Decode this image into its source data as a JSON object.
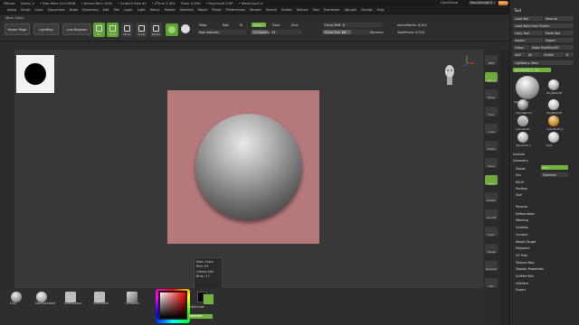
{
  "titlebar": {
    "items": [
      "ZBrush",
      "Demo_3",
      "• Free Mem 21.026GB",
      "• Active Mem 1004",
      "• Scratch Disk 49",
      "• ZTime 3.354",
      "Timer 0.009",
      "• PolyCount 0 KP",
      "• MeshCount 0"
    ],
    "quicksave": "QuickSave",
    "seethrough": "See-through 0",
    "menus": "Menus",
    "defaultscript": "DefaultZScript"
  },
  "menubar": [
    "Alpha",
    "Brush",
    "Color",
    "Document",
    "Draw",
    "Dynamics",
    "Edit",
    "File",
    "Layer",
    "Light",
    "Macro",
    "Marker",
    "Material",
    "Movie",
    "Picker",
    "Preferences",
    "Render",
    "Stencil",
    "Stroke",
    "Texture",
    "Tool",
    "Transform",
    "Zplugin",
    "Zscript",
    "Help"
  ],
  "header": {
    "main_color_label": "Main Color"
  },
  "shelf": {
    "home_page": "Home Page",
    "lightbox": "LightBox",
    "live_boolean": "Live Boolean",
    "tools": [
      {
        "label": "Edit",
        "active": true
      },
      {
        "label": "Draw",
        "active": true
      },
      {
        "label": "Move",
        "active": false
      },
      {
        "label": "Scale",
        "active": false
      },
      {
        "label": "Rotate",
        "active": false
      }
    ],
    "mrgb": "Mrgb",
    "rgb": "Rgb",
    "m": "M",
    "zadd": "Zadd",
    "zsub": "Zsub",
    "zcut": "Zcut",
    "rgb_intensity": "Rgb Intensity",
    "z_intensity_label": "Z Intensity",
    "z_intensity_value": "25",
    "focal_shift_label": "Focal Shift",
    "focal_shift_value": "0",
    "draw_size_label": "Draw Size",
    "draw_size_value": "64",
    "dynamic": "Dynamic",
    "active_points": "ActivePoints: 8,320",
    "total_points": "TotalPoints: 8,320"
  },
  "tooltip": {
    "title": "Main Color",
    "red": "Red :91",
    "green": "Green:164",
    "blue": "Blue :17"
  },
  "right_strip": [
    "BPR",
    "SPix 3",
    "Persp",
    "Floor",
    "Local",
    "Frame",
    "Move",
    "Scale",
    "Rotate",
    "Line Fill",
    "PolyF",
    "Transp",
    "Dynamic",
    "Solo"
  ],
  "tool_panel": {
    "title": "Tool",
    "buttons": [
      "Load Tool",
      "Save As",
      "Load Tools From Project",
      "Copy Tool",
      "Paste Tool",
      "Import",
      "Export",
      "Clone",
      "Make PolyMesh3D",
      "GoZ",
      "All",
      "Visible",
      "R"
    ],
    "lightbox_tools": "Lightbox ▸ Tools",
    "sphere_slider": "Sphere3D_1. 48",
    "thumbnails": [
      "Sphere3D_1",
      "PolyMesh3D",
      "SimpleBrush",
      "PolyMesh3D",
      "Cylinder3D",
      "Cylinder3D_1",
      "Sphere3D_1",
      "Eyes"
    ],
    "subtool": "Subtool",
    "geometry": "Geometry",
    "divide": "Divide",
    "smt": "Smt",
    "suv": "Suv",
    "rel": "ReUV",
    "optimize": "Optimize",
    "position": "Position",
    "size": "Size",
    "sections": [
      "Preview",
      "Deformation",
      "Masking",
      "Visibility",
      "Contact",
      "Morph Target",
      "Polypaint",
      "UV Map",
      "Texture Map",
      "Display Properties",
      "Unified Skin",
      "Initialize",
      "Export"
    ]
  },
  "bottom_shelf": {
    "brushes": [
      "Clay",
      "DamStandard",
      "SelectLasso",
      "SelectRect",
      "ZModeler"
    ],
    "switch_color": "SwitchColor",
    "alternate": "Alternate"
  },
  "colors": {
    "accent": "#6fb43c",
    "main_color": "#5ba411",
    "canvas": "#383838",
    "document": "#b5797b"
  }
}
